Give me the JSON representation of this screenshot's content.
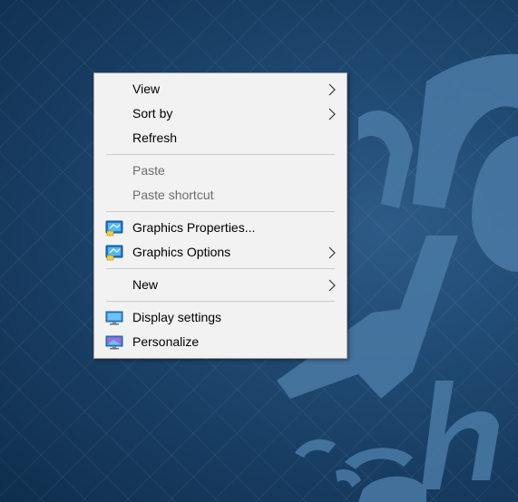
{
  "context_menu": {
    "items": [
      {
        "label": "View"
      },
      {
        "label": "Sort by"
      },
      {
        "label": "Refresh"
      },
      {
        "label": "Paste"
      },
      {
        "label": "Paste shortcut"
      },
      {
        "label": "Graphics Properties..."
      },
      {
        "label": "Graphics Options"
      },
      {
        "label": "New"
      },
      {
        "label": "Display settings"
      },
      {
        "label": "Personalize"
      }
    ],
    "icons": {
      "graphics_properties": "intel-graphics-icon",
      "graphics_options": "intel-graphics-icon",
      "display_settings": "monitor-icon",
      "personalize": "personalize-monitor-icon"
    }
  },
  "colors": {
    "desktop_background": "#1f4a73",
    "menu_background": "#f2f2f2",
    "menu_border": "#a0a0a0",
    "disabled_text": "#6d6d6d"
  }
}
